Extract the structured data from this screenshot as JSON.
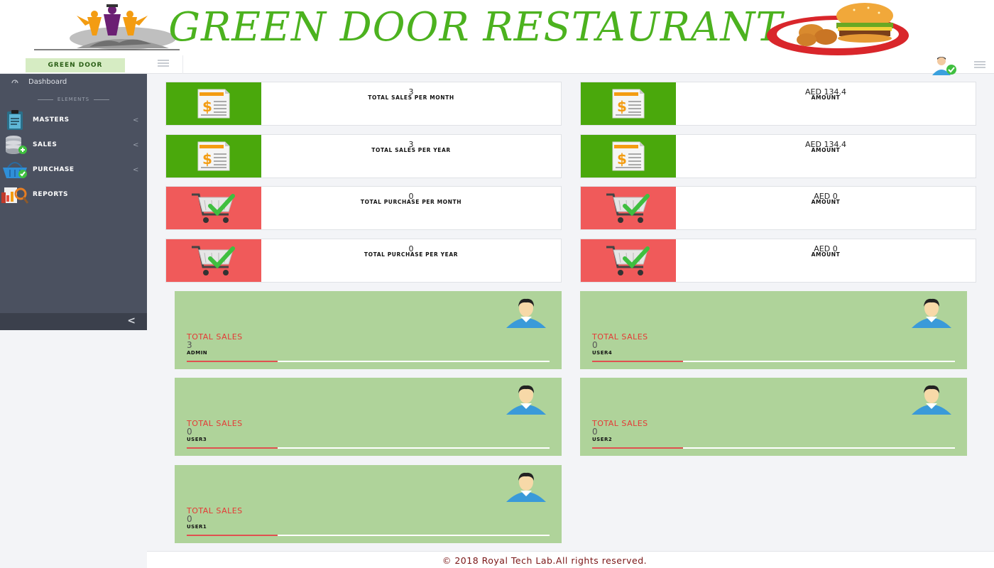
{
  "header": {
    "title": "GREEN DOOR RESTAURANT",
    "brand_label": "GREEN DOOR",
    "colors": {
      "title": "#4cb21f",
      "green": "#4aa80c",
      "red": "#f05a5a",
      "panel": "#afd39a"
    }
  },
  "sidebar": {
    "dashboard_label": "Dashboard",
    "section_label": "ELEMENTS",
    "items": [
      {
        "label": "MASTERS",
        "icon": "clipboard-icon"
      },
      {
        "label": "SALES",
        "icon": "database-icon"
      },
      {
        "label": "PURCHASE",
        "icon": "basket-icon"
      },
      {
        "label": "REPORTS",
        "icon": "reports-icon"
      }
    ],
    "chevron": "<",
    "collapse": "<"
  },
  "stats": [
    {
      "value": "3",
      "label": "TOTAL SALES PER MONTH",
      "icon": "invoice-icon",
      "tone": "green"
    },
    {
      "value": "AED 134.4",
      "label": "AMOUNT",
      "icon": "invoice-icon",
      "tone": "green"
    },
    {
      "value": "3",
      "label": "TOTAL SALES PER YEAR",
      "icon": "invoice-icon",
      "tone": "green"
    },
    {
      "value": "AED 134.4",
      "label": "AMOUNT",
      "icon": "invoice-icon",
      "tone": "green"
    },
    {
      "value": "0",
      "label": "TOTAL PURCHASE PER MONTH",
      "icon": "cart-icon",
      "tone": "red"
    },
    {
      "value": "AED 0",
      "label": "AMOUNT",
      "icon": "cart-icon",
      "tone": "red"
    },
    {
      "value": "0",
      "label": "TOTAL PURCHASE PER YEAR",
      "icon": "cart-icon",
      "tone": "red"
    },
    {
      "value": "AED 0",
      "label": "AMOUNT",
      "icon": "cart-icon",
      "tone": "red"
    }
  ],
  "users": [
    {
      "title": "TOTAL SALES",
      "value": "3",
      "name": "ADMIN"
    },
    {
      "title": "TOTAL SALES",
      "value": "0",
      "name": "USER4"
    },
    {
      "title": "TOTAL SALES",
      "value": "0",
      "name": "USER3"
    },
    {
      "title": "TOTAL SALES",
      "value": "0",
      "name": "USER2"
    },
    {
      "title": "TOTAL SALES",
      "value": "0",
      "name": "USER1"
    }
  ],
  "footer": {
    "text": "© 2018 Royal Tech Lab.All rights reserved."
  }
}
